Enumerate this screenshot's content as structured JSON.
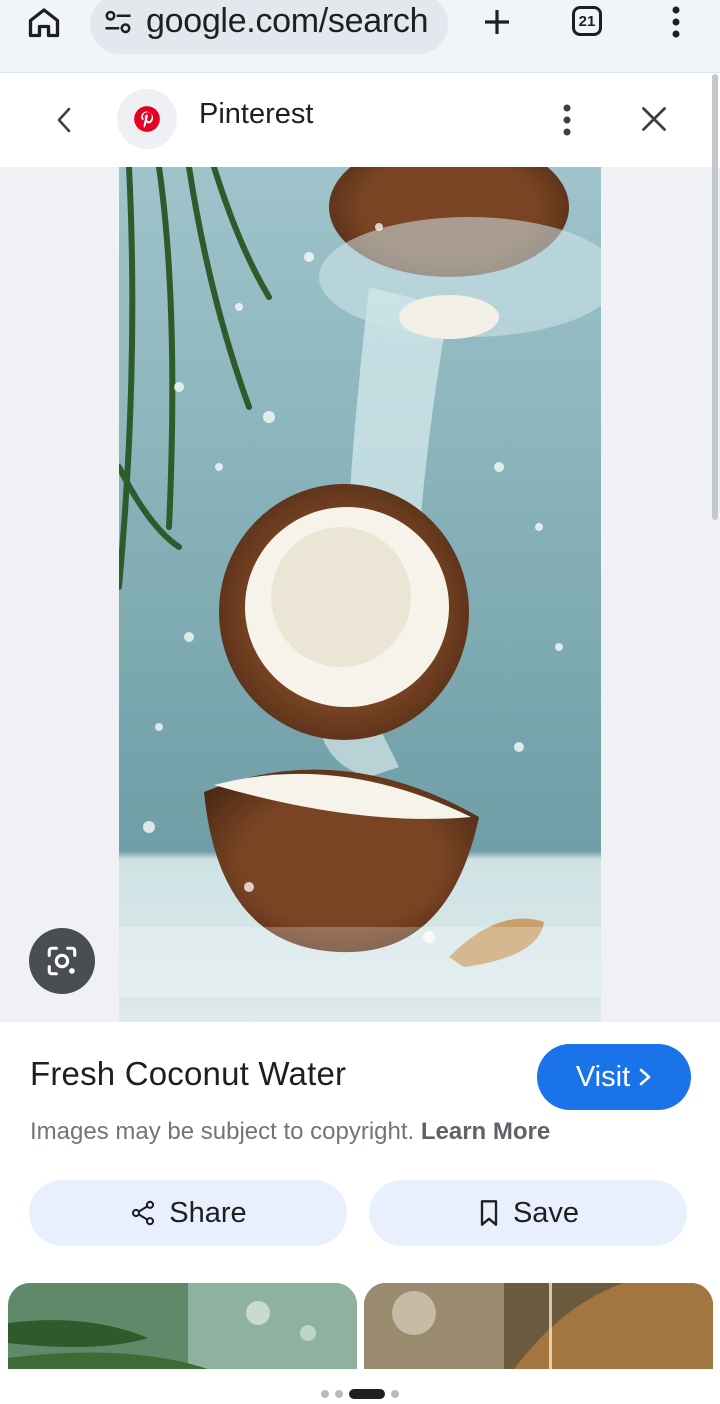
{
  "browser": {
    "url": "google.com/search",
    "tab_count": "21",
    "icons": [
      "home-icon",
      "site-settings-icon",
      "new-tab-icon",
      "tab-switcher-icon",
      "more-icon"
    ]
  },
  "panel": {
    "site_name": "Pinterest",
    "icons": [
      "back-icon",
      "pinterest-logo-icon",
      "more-options-icon",
      "close-icon"
    ]
  },
  "result": {
    "title": "Fresh Coconut Water",
    "visit_label": "Visit",
    "copyright_text": "Images may be subject to copyright.",
    "learn_more": "Learn More",
    "share_label": "Share",
    "save_label": "Save"
  },
  "pagination": {
    "total": 4,
    "active_index": 2
  },
  "colors": {
    "accent": "#1a73e8",
    "button_bg": "#e8f0fe",
    "pinterest_red": "#e60023"
  }
}
